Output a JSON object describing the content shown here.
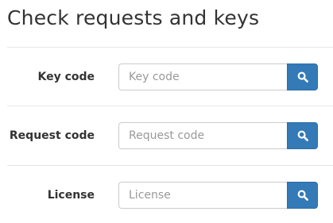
{
  "page": {
    "title": "Check requests and keys"
  },
  "form": {
    "rows": [
      {
        "label": "Key code",
        "placeholder": "Key code",
        "value": "",
        "button_icon": "search-icon"
      },
      {
        "label": "Request code",
        "placeholder": "Request code",
        "value": "",
        "button_icon": "search-icon"
      },
      {
        "label": "License",
        "placeholder": "License",
        "value": "",
        "button_icon": "search-icon"
      }
    ]
  },
  "colors": {
    "button_bg": "#337ab7",
    "button_border": "#2e6da4",
    "text": "#333333",
    "placeholder": "#999999",
    "divider": "#e7e7e7"
  }
}
